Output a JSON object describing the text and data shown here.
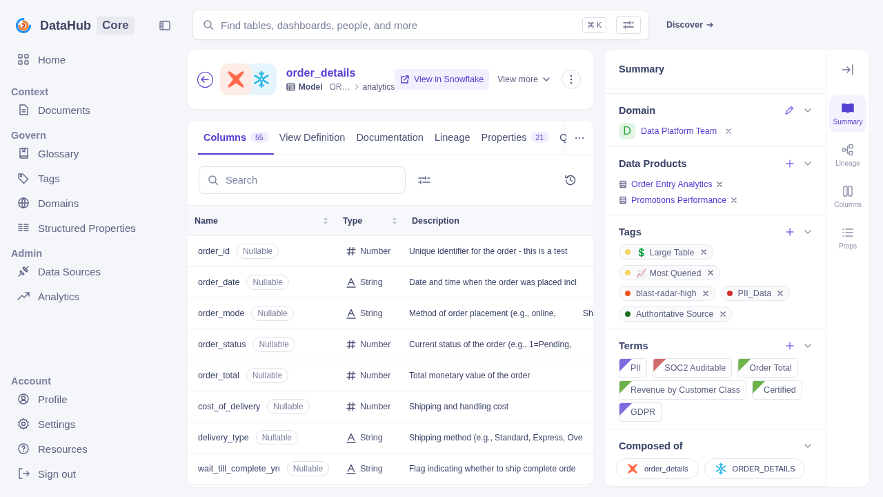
{
  "brand": {
    "name": "DataHub",
    "edition": "Core"
  },
  "sidebar": {
    "items": [
      {
        "label": "Home"
      }
    ],
    "sections": [
      {
        "title": "Context",
        "items": [
          {
            "label": "Documents"
          }
        ]
      },
      {
        "title": "Govern",
        "items": [
          {
            "label": "Glossary"
          },
          {
            "label": "Tags"
          },
          {
            "label": "Domains"
          },
          {
            "label": "Structured Properties"
          }
        ]
      },
      {
        "title": "Admin",
        "items": [
          {
            "label": "Data Sources"
          },
          {
            "label": "Analytics"
          }
        ]
      }
    ],
    "footer": {
      "title": "Account",
      "items": [
        {
          "label": "Profile"
        },
        {
          "label": "Settings"
        },
        {
          "label": "Resources"
        },
        {
          "label": "Sign out"
        }
      ]
    }
  },
  "search": {
    "placeholder": "Find tables, dashboards, people, and more",
    "shortcut": "⌘ K"
  },
  "discover_link": "Discover",
  "entity": {
    "name": "order_details",
    "subtype": "Model",
    "container": "OR…",
    "path": "analytics",
    "primary_action": "View in Snowflake",
    "menu": "View more"
  },
  "tabs": [
    {
      "label": "Columns",
      "count": "55",
      "selected": true
    },
    {
      "label": "View Definition",
      "selected": false
    },
    {
      "label": "Documentation",
      "selected": false
    },
    {
      "label": "Lineage",
      "selected": false
    },
    {
      "label": "Properties",
      "count": "21",
      "selected": false
    },
    {
      "label": "Q",
      "selected": false
    }
  ],
  "columns_search": {
    "placeholder": "Search"
  },
  "table": {
    "columns": [
      {
        "label": "Name",
        "sortable": true
      },
      {
        "label": "Type",
        "sortable": true
      },
      {
        "label": "Description",
        "sortable": false
      }
    ],
    "rows": [
      {
        "name": "order_id",
        "badge": "Nullable",
        "type": "Number",
        "kind": "number",
        "description": "Unique identifier for the order - this is a test"
      },
      {
        "name": "order_date",
        "badge": "Nullable",
        "type": "String",
        "kind": "string",
        "description": "Date and time when the order was placed incl"
      },
      {
        "name": "order_mode",
        "badge": "Nullable",
        "type": "String",
        "kind": "string",
        "description": "Method of order placement (e.g., online,",
        "column_4": "Sh"
      },
      {
        "name": "order_status",
        "badge": "Nullable",
        "type": "Number",
        "kind": "number",
        "description": "Current status of the order (e.g., 1=Pending,"
      },
      {
        "name": "order_total",
        "badge": "Nullable",
        "type": "Number",
        "kind": "number",
        "description": "Total monetary value of the order"
      },
      {
        "name": "cost_of_delivery",
        "badge": "Nullable",
        "type": "Number",
        "kind": "number",
        "description": "Shipping and handling cost"
      },
      {
        "name": "delivery_type",
        "badge": "Nullable",
        "type": "String",
        "kind": "string",
        "description": "Shipping method (e.g., Standard, Express, Ove"
      },
      {
        "name": "wait_till_complete_yn",
        "badge": "Nullable",
        "type": "String",
        "kind": "string",
        "description": "Flag indicating whether to ship complete orde"
      }
    ]
  },
  "summary": {
    "title": "Summary",
    "sections": [
      {
        "kind": "domain",
        "title": "Domain",
        "items": [
          {
            "initial": "D",
            "label": "Data Platform Team"
          }
        ]
      },
      {
        "kind": "products",
        "title": "Data Products",
        "items": [
          {
            "label": "Order Entry Analytics"
          },
          {
            "label": "Promotions Performance"
          }
        ]
      },
      {
        "kind": "tags",
        "title": "Tags",
        "items": [
          {
            "label": "💲 Large Table",
            "color": "#f8d35e"
          },
          {
            "label": "📈 Most Queried",
            "color": "#f8d35e"
          },
          {
            "label": "blast-radar-high",
            "color": "#f0531c"
          },
          {
            "label": "PII_Data",
            "color": "#d32f2f"
          },
          {
            "label": "Authoritative Source",
            "color": "#1b6e1e"
          }
        ]
      },
      {
        "kind": "terms",
        "title": "Terms",
        "items": [
          {
            "label": "PII",
            "color": "#7d6be0"
          },
          {
            "label": "SOC2 Auditable",
            "color": "#d26b6b"
          },
          {
            "label": "Order Total",
            "color": "#6db24a"
          },
          {
            "label": "Revenue by Customer Class",
            "color": "#6db24a"
          },
          {
            "label": "Certified",
            "color": "#6db24a"
          },
          {
            "label": "GDPR",
            "color": "#7d6be0"
          }
        ]
      },
      {
        "kind": "composed",
        "title": "Composed of",
        "items": [
          {
            "label": "order_details",
            "kind": "dbt"
          },
          {
            "label": "ORDER_DETAILS",
            "kind": "snowflake"
          }
        ]
      }
    ]
  },
  "rail": {
    "items": [
      {
        "label": "Summary",
        "selected": true
      },
      {
        "label": "Lineage",
        "selected": false
      },
      {
        "label": "Columns",
        "selected": false
      },
      {
        "label": "Props",
        "selected": false
      }
    ]
  }
}
